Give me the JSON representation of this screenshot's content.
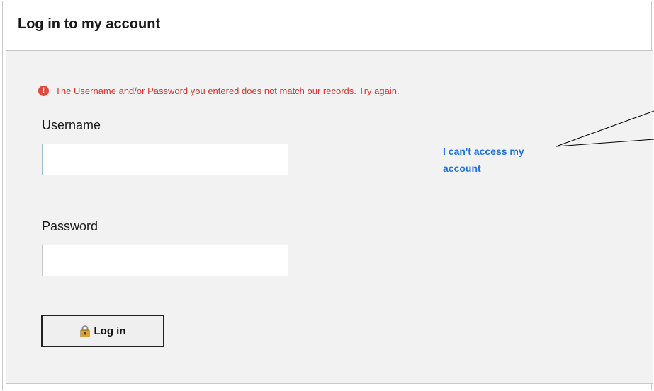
{
  "page": {
    "title": "Log in to my account"
  },
  "error": {
    "message": "The Username and/or Password you entered does not match our records. Try again.",
    "icon": "error-icon",
    "color": "#d9332b"
  },
  "form": {
    "username_label": "Username",
    "username_value": "",
    "password_label": "Password",
    "password_value": "",
    "login_label": "Log in",
    "login_icon": "lock-icon"
  },
  "help": {
    "access_link": "I can't access my account",
    "link_color": "#1e73e6"
  }
}
